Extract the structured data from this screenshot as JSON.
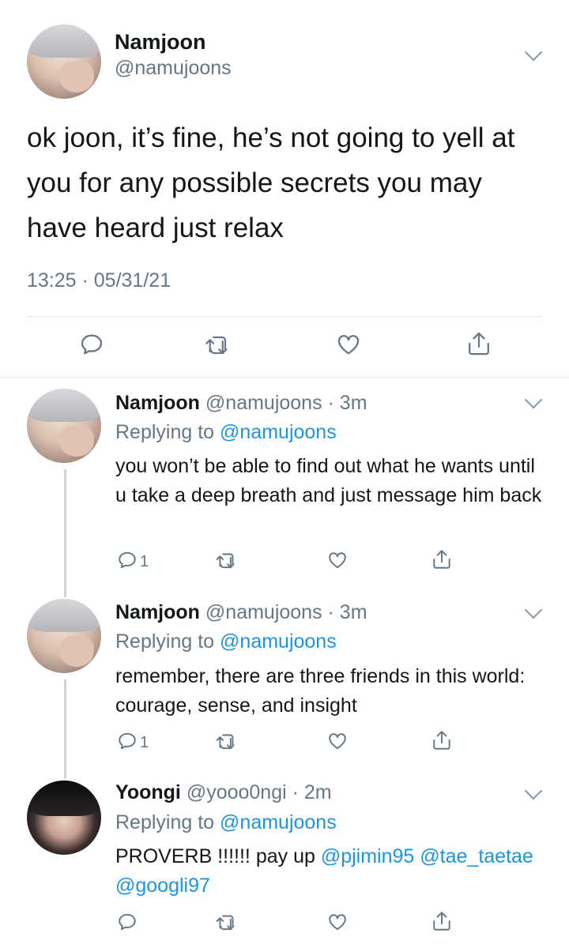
{
  "main_tweet": {
    "name": "Namjoon",
    "handle": "@namujoons",
    "text": "ok joon, it’s fine, he’s not going to yell at you for any possible secrets you may have heard just relax",
    "timestamp": "13:25 · 05/31/21"
  },
  "replies": [
    {
      "name": "Namjoon",
      "handle_time": "@namujoons · 3m",
      "replying_prefix": "Replying to",
      "replying_to": "@namujoons",
      "text": "you won’t be able to find out what he wants until u take a deep breath and just message him back",
      "reply_count": "1"
    },
    {
      "name": "Namjoon",
      "handle_time": "@namujoons · 3m",
      "replying_prefix": "Replying to",
      "replying_to": "@namujoons",
      "text": "remember, there are three friends in this world: courage, sense, and insight",
      "reply_count": "1"
    },
    {
      "name": "Yoongi",
      "handle_time": "@yooo0ngi · 2m",
      "replying_prefix": "Replying to",
      "replying_to": "@namujoons",
      "text": "PROVERB !!!!!! pay up",
      "mentions": [
        "@pjimin95",
        "@tae_taetae",
        "@googli97"
      ]
    }
  ],
  "icons": [
    "reply-icon",
    "retweet-icon",
    "like-icon",
    "share-icon",
    "chevron-down-icon"
  ],
  "colors": {
    "link": "#1b95e0",
    "secondary_text": "#657786",
    "divider": "#e1e8ed"
  }
}
